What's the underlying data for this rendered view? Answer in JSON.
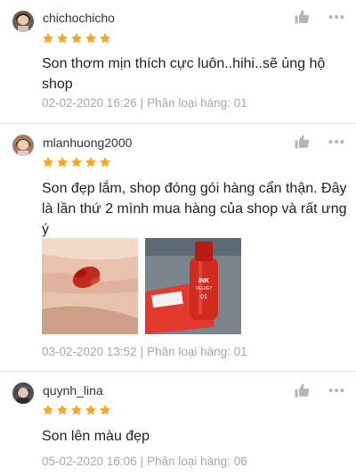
{
  "colors": {
    "star": "#f5a623",
    "meta_text": "#a8a8a8",
    "divider": "#e6e6e6"
  },
  "reviews": [
    {
      "username": "chichochicho",
      "rating": 5,
      "content": "Son thơm mịn thích cực luôn..hihi..sẽ ủng hộ shop",
      "date": "02-02-2020 16:26",
      "variation_label": "Phân loại hàng:",
      "variation_value": "01",
      "separator": "|"
    },
    {
      "username": "mlanhuong2000",
      "rating": 5,
      "content": "Son đẹp lắm, shop đóng gói hàng cẩn thận. Đây là lần thứ 2 mình mua hàng của shop và rất ưng ý",
      "emoji": "👍👍👍",
      "photos": [
        "lipstick-swatch-photo",
        "lipstick-product-photo"
      ],
      "photo_text": {
        "brand": "INK",
        "line": "VELVET",
        "shade": "01"
      },
      "date": "03-02-2020 13:52",
      "variation_label": "Phân loại hàng:",
      "variation_value": "01",
      "separator": "|"
    },
    {
      "username": "quynh_lina",
      "rating": 5,
      "content": "Son lên màu đẹp",
      "date": "05-02-2020 16:06",
      "variation_label": "Phân loại hàng:",
      "variation_value": "06",
      "separator": "|"
    }
  ]
}
